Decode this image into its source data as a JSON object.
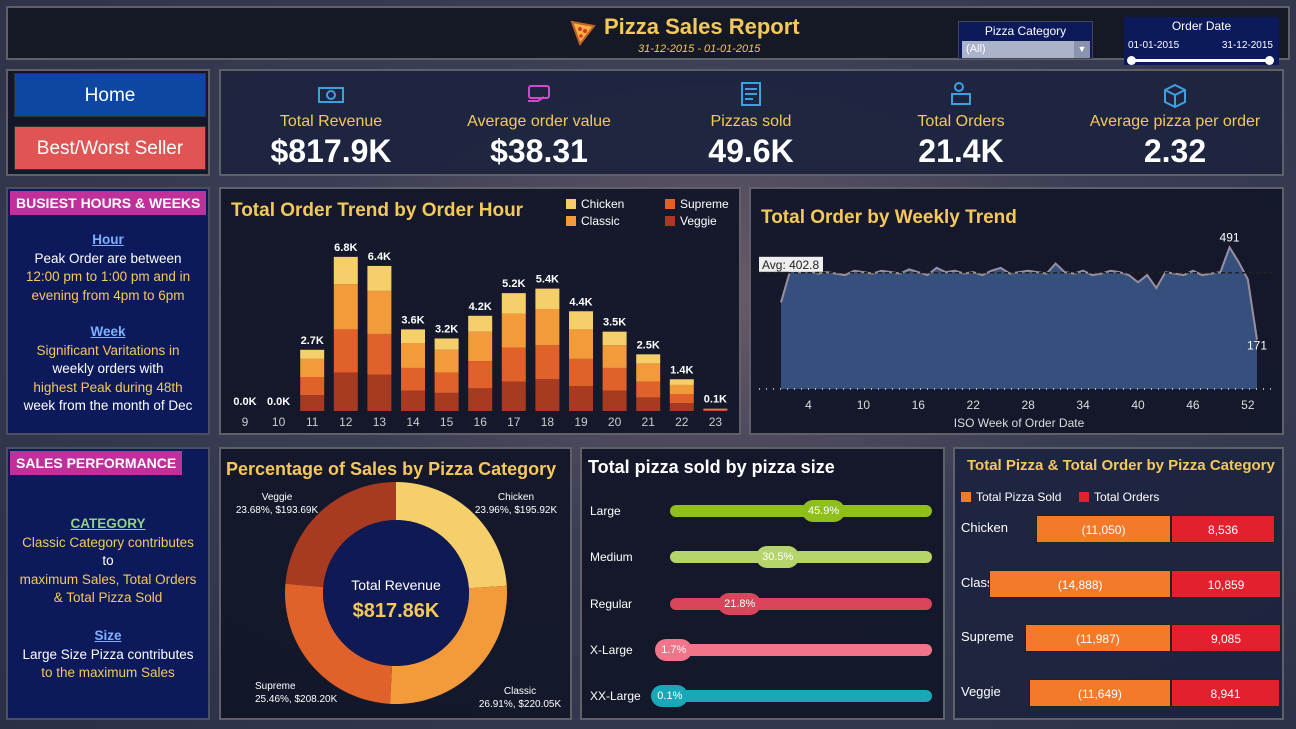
{
  "header": {
    "title": "Pizza Sales Report",
    "dates": "31-12-2015 - 01-01-2015",
    "category_slicer": {
      "label": "Pizza Category",
      "value": "(All)"
    },
    "date_slicer": {
      "label": "Order Date",
      "start": "01-01-2015",
      "end": "31-12-2015"
    }
  },
  "nav": {
    "home": "Home",
    "best_worst": "Best/Worst Seller"
  },
  "kpis": [
    {
      "label": "Total Revenue",
      "value": "$817.9K",
      "icon": "money-icon"
    },
    {
      "label": "Average order value",
      "value": "$38.31",
      "icon": "card-icon"
    },
    {
      "label": "Pizzas sold",
      "value": "49.6K",
      "icon": "checklist-icon"
    },
    {
      "label": "Total Orders",
      "value": "21.4K",
      "icon": "delivery-icon"
    },
    {
      "label": "Average pizza per order",
      "value": "2.32",
      "icon": "box-icon"
    }
  ],
  "busiest": {
    "badge": "BUSIEST HOURS & WEEKS",
    "hour_heading": "Hour",
    "hour_lines": [
      "Peak Order are between",
      "12:00 pm to 1:00 pm and in",
      "evening from 4pm to 6pm"
    ],
    "week_heading": "Week",
    "week_lines": [
      "Significant Varitations in",
      "weekly orders with",
      "highest Peak during 48th",
      "week from the month of Dec"
    ]
  },
  "sales_perf": {
    "badge": "SALES PERFORMANCE",
    "cat_heading": "CATEGORY",
    "cat_lines": [
      "Classic Category contributes",
      "to",
      "maximum Sales, Total Orders",
      "& Total Pizza Sold"
    ],
    "size_heading": "Size",
    "size_lines": [
      "Large Size Pizza contributes",
      "to the maximum Sales"
    ]
  },
  "colors": {
    "chicken": "#f5d06a",
    "classic": "#f39a3a",
    "supreme": "#e0612a",
    "veggie": "#a83a22",
    "accent": "#f5c85a"
  },
  "chart_data": [
    {
      "type": "bar",
      "title": "Total Order Trend by Order Hour",
      "categories": [
        "9",
        "10",
        "11",
        "12",
        "13",
        "14",
        "15",
        "16",
        "17",
        "18",
        "19",
        "20",
        "21",
        "22",
        "23"
      ],
      "totals_labels": [
        "0.0K",
        "0.0K",
        "2.7K",
        "6.8K",
        "6.4K",
        "3.6K",
        "3.2K",
        "4.2K",
        "5.2K",
        "5.4K",
        "4.4K",
        "3.5K",
        "2.5K",
        "1.4K",
        "0.1K"
      ],
      "series": [
        {
          "name": "Chicken",
          "values": [
            0,
            0,
            0.4,
            1.2,
            1.1,
            0.6,
            0.5,
            0.7,
            0.9,
            0.9,
            0.8,
            0.6,
            0.4,
            0.25,
            0.02
          ]
        },
        {
          "name": "Classic",
          "values": [
            0,
            0,
            0.8,
            2.0,
            1.9,
            1.1,
            1.0,
            1.3,
            1.5,
            1.6,
            1.3,
            1.0,
            0.8,
            0.4,
            0.03
          ]
        },
        {
          "name": "Supreme",
          "values": [
            0,
            0,
            0.8,
            1.9,
            1.8,
            1.0,
            0.9,
            1.2,
            1.5,
            1.5,
            1.2,
            1.0,
            0.7,
            0.4,
            0.03
          ]
        },
        {
          "name": "Veggie",
          "values": [
            0,
            0,
            0.7,
            1.7,
            1.6,
            0.9,
            0.8,
            1.0,
            1.3,
            1.4,
            1.1,
            0.9,
            0.6,
            0.35,
            0.02
          ]
        }
      ],
      "ylim": [
        0,
        7.5
      ]
    },
    {
      "type": "area",
      "title": "Total Order by Weekly Trend",
      "xlabel": "ISO Week of Order Date",
      "x_ticks": [
        4,
        10,
        16,
        22,
        28,
        34,
        40,
        46,
        52
      ],
      "average": 402.8,
      "average_label": "Avg: 402.8",
      "peak_label": "491",
      "min_label": "171",
      "x": [
        1,
        2,
        3,
        4,
        5,
        6,
        7,
        8,
        9,
        10,
        11,
        12,
        13,
        14,
        15,
        16,
        17,
        18,
        19,
        20,
        21,
        22,
        23,
        24,
        25,
        26,
        27,
        28,
        29,
        30,
        31,
        32,
        33,
        34,
        35,
        36,
        37,
        38,
        39,
        40,
        41,
        42,
        43,
        44,
        45,
        46,
        47,
        48,
        49,
        50,
        51,
        52,
        53
      ],
      "values": [
        300,
        410,
        405,
        410,
        400,
        405,
        400,
        395,
        410,
        405,
        400,
        410,
        405,
        400,
        415,
        405,
        395,
        420,
        405,
        410,
        400,
        405,
        395,
        410,
        420,
        400,
        405,
        410,
        405,
        400,
        435,
        405,
        400,
        410,
        395,
        400,
        410,
        405,
        395,
        370,
        395,
        350,
        405,
        400,
        395,
        410,
        395,
        400,
        405,
        491,
        440,
        380,
        171
      ],
      "ylim": [
        0,
        520
      ]
    },
    {
      "type": "pie",
      "title": "Percentage of Sales by Pizza Category",
      "center_label": "Total Revenue",
      "center_value": "$817.86K",
      "slices": [
        {
          "name": "Chicken",
          "pct": 23.96,
          "label": "23.96%, $195.92K"
        },
        {
          "name": "Classic",
          "pct": 26.91,
          "label": "26.91%, $220.05K"
        },
        {
          "name": "Supreme",
          "pct": 25.46,
          "label": "25.46%, $208.20K"
        },
        {
          "name": "Veggie",
          "pct": 23.68,
          "label": "23.68%, $193.69K"
        }
      ]
    },
    {
      "type": "bar",
      "title": "Total pizza sold by pizza size",
      "categories": [
        "Large",
        "Medium",
        "Regular",
        "X-Large",
        "XX-Large"
      ],
      "values": [
        45.9,
        30.5,
        21.8,
        1.7,
        0.1
      ],
      "labels": [
        "45.9%",
        "30.5%",
        "21.8%",
        "1.7%",
        "0.1%"
      ],
      "bar_colors": [
        "#8fbf1a",
        "#b5d46a",
        "#d9455a",
        "#f0758a",
        "#1aa8b8"
      ]
    },
    {
      "type": "bar",
      "title": "Total Pizza & Total Order by Pizza Category",
      "legend": [
        "Total Pizza Sold",
        "Total Orders"
      ],
      "categories": [
        "Chicken",
        "Classic",
        "Supreme",
        "Veggie"
      ],
      "series": [
        {
          "name": "Total Pizza Sold",
          "values": [
            11050,
            14888,
            11987,
            11649
          ],
          "labels": [
            "(11,050)",
            "(14,888)",
            "(11,987)",
            "(11,649)"
          ]
        },
        {
          "name": "Total Orders",
          "values": [
            8536,
            10859,
            9085,
            8941
          ],
          "labels": [
            "8,536",
            "10,859",
            "9,085",
            "8,941"
          ]
        }
      ]
    }
  ]
}
